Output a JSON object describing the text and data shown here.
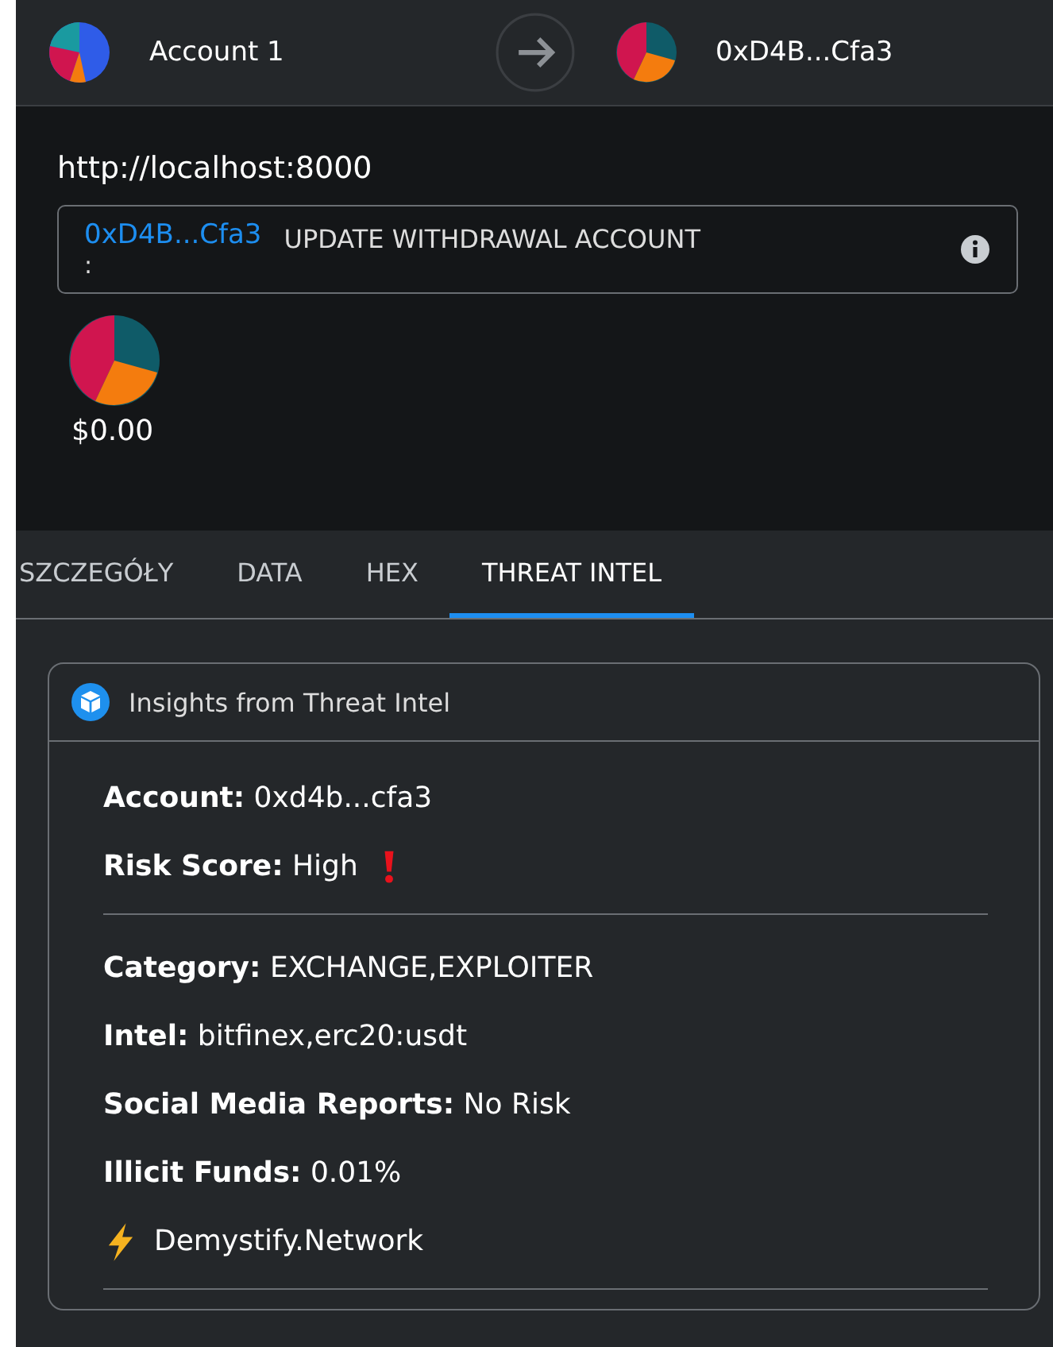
{
  "header": {
    "from_account": "Account 1",
    "to_account": "0xD4B...Cfa3"
  },
  "origin": "http://localhost:8000",
  "method": {
    "address": "0xD4B...Cfa3",
    "separator": ":",
    "name": "UPDATE WITHDRAWAL ACCOUNT"
  },
  "balance": "$0.00",
  "tabs": [
    {
      "label": "SZCZEGÓŁY",
      "selected": false
    },
    {
      "label": "DATA",
      "selected": false
    },
    {
      "label": "HEX",
      "selected": false
    },
    {
      "label": "THREAT INTEL",
      "selected": true
    }
  ],
  "insights": {
    "title": "Insights from Threat Intel",
    "sections": [
      {
        "rows": [
          {
            "kind": "plain",
            "text": "**Account:** 0xd4b...cfa3"
          },
          {
            "kind": "risk",
            "text": "**Risk Score:** High"
          }
        ]
      },
      {
        "rows": [
          {
            "kind": "plain",
            "text": "**Category:** EXCHANGE,EXPLOITER"
          },
          {
            "kind": "plain",
            "text": "**Intel:** bitfinex,erc20:usdt"
          },
          {
            "kind": "plain",
            "text": "**Social Media Reports:** No Risk"
          },
          {
            "kind": "plain",
            "text": "**Illicit Funds:** 0.01%"
          },
          {
            "kind": "source",
            "text": "Demystify.Network"
          }
        ]
      }
    ]
  }
}
